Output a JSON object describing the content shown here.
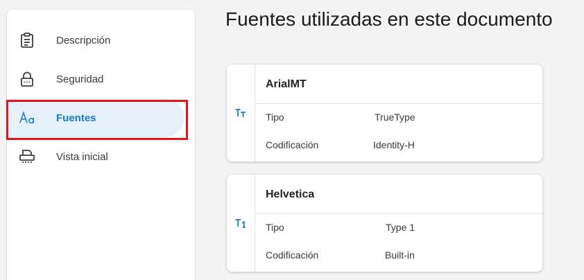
{
  "sidebar": {
    "items": [
      {
        "label": "Descripción",
        "icon": "clipboard-icon"
      },
      {
        "label": "Seguridad",
        "icon": "lock-icon"
      },
      {
        "label": "Fuentes",
        "icon": "font-aa-icon"
      },
      {
        "label": "Vista inicial",
        "icon": "printer-view-icon"
      }
    ],
    "active_index": 2
  },
  "main": {
    "title": "Fuentes utilizadas en este documento",
    "fonts": [
      {
        "name": "ArialMT",
        "icon": "truetype-font-icon",
        "type_label": "Tipo",
        "type_value": "TrueType",
        "encoding_label": "Codificación",
        "encoding_value": "Identity-H"
      },
      {
        "name": "Helvetica",
        "icon": "type1-font-icon",
        "type_label": "Tipo",
        "type_value": "Type 1",
        "encoding_label": "Codificación",
        "encoding_value": "Built-in"
      }
    ]
  },
  "colors": {
    "accent": "#1a7bbf",
    "active_bg": "#e4f1fb",
    "highlight": "#e0141a"
  }
}
